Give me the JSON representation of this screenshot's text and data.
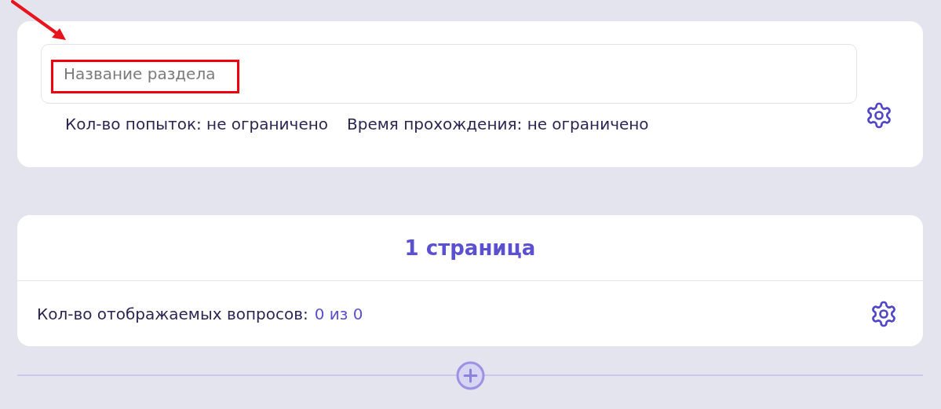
{
  "section": {
    "name_field": {
      "placeholder": "Название раздела"
    },
    "limits": [
      "Кол-во попыток: не ограничено",
      "Время прохождения: не ограничено"
    ]
  },
  "page": {
    "title": "1 страница",
    "questions_label": "Кол-во отображаемых вопросов:",
    "questions_value": "0 из 0"
  }
}
